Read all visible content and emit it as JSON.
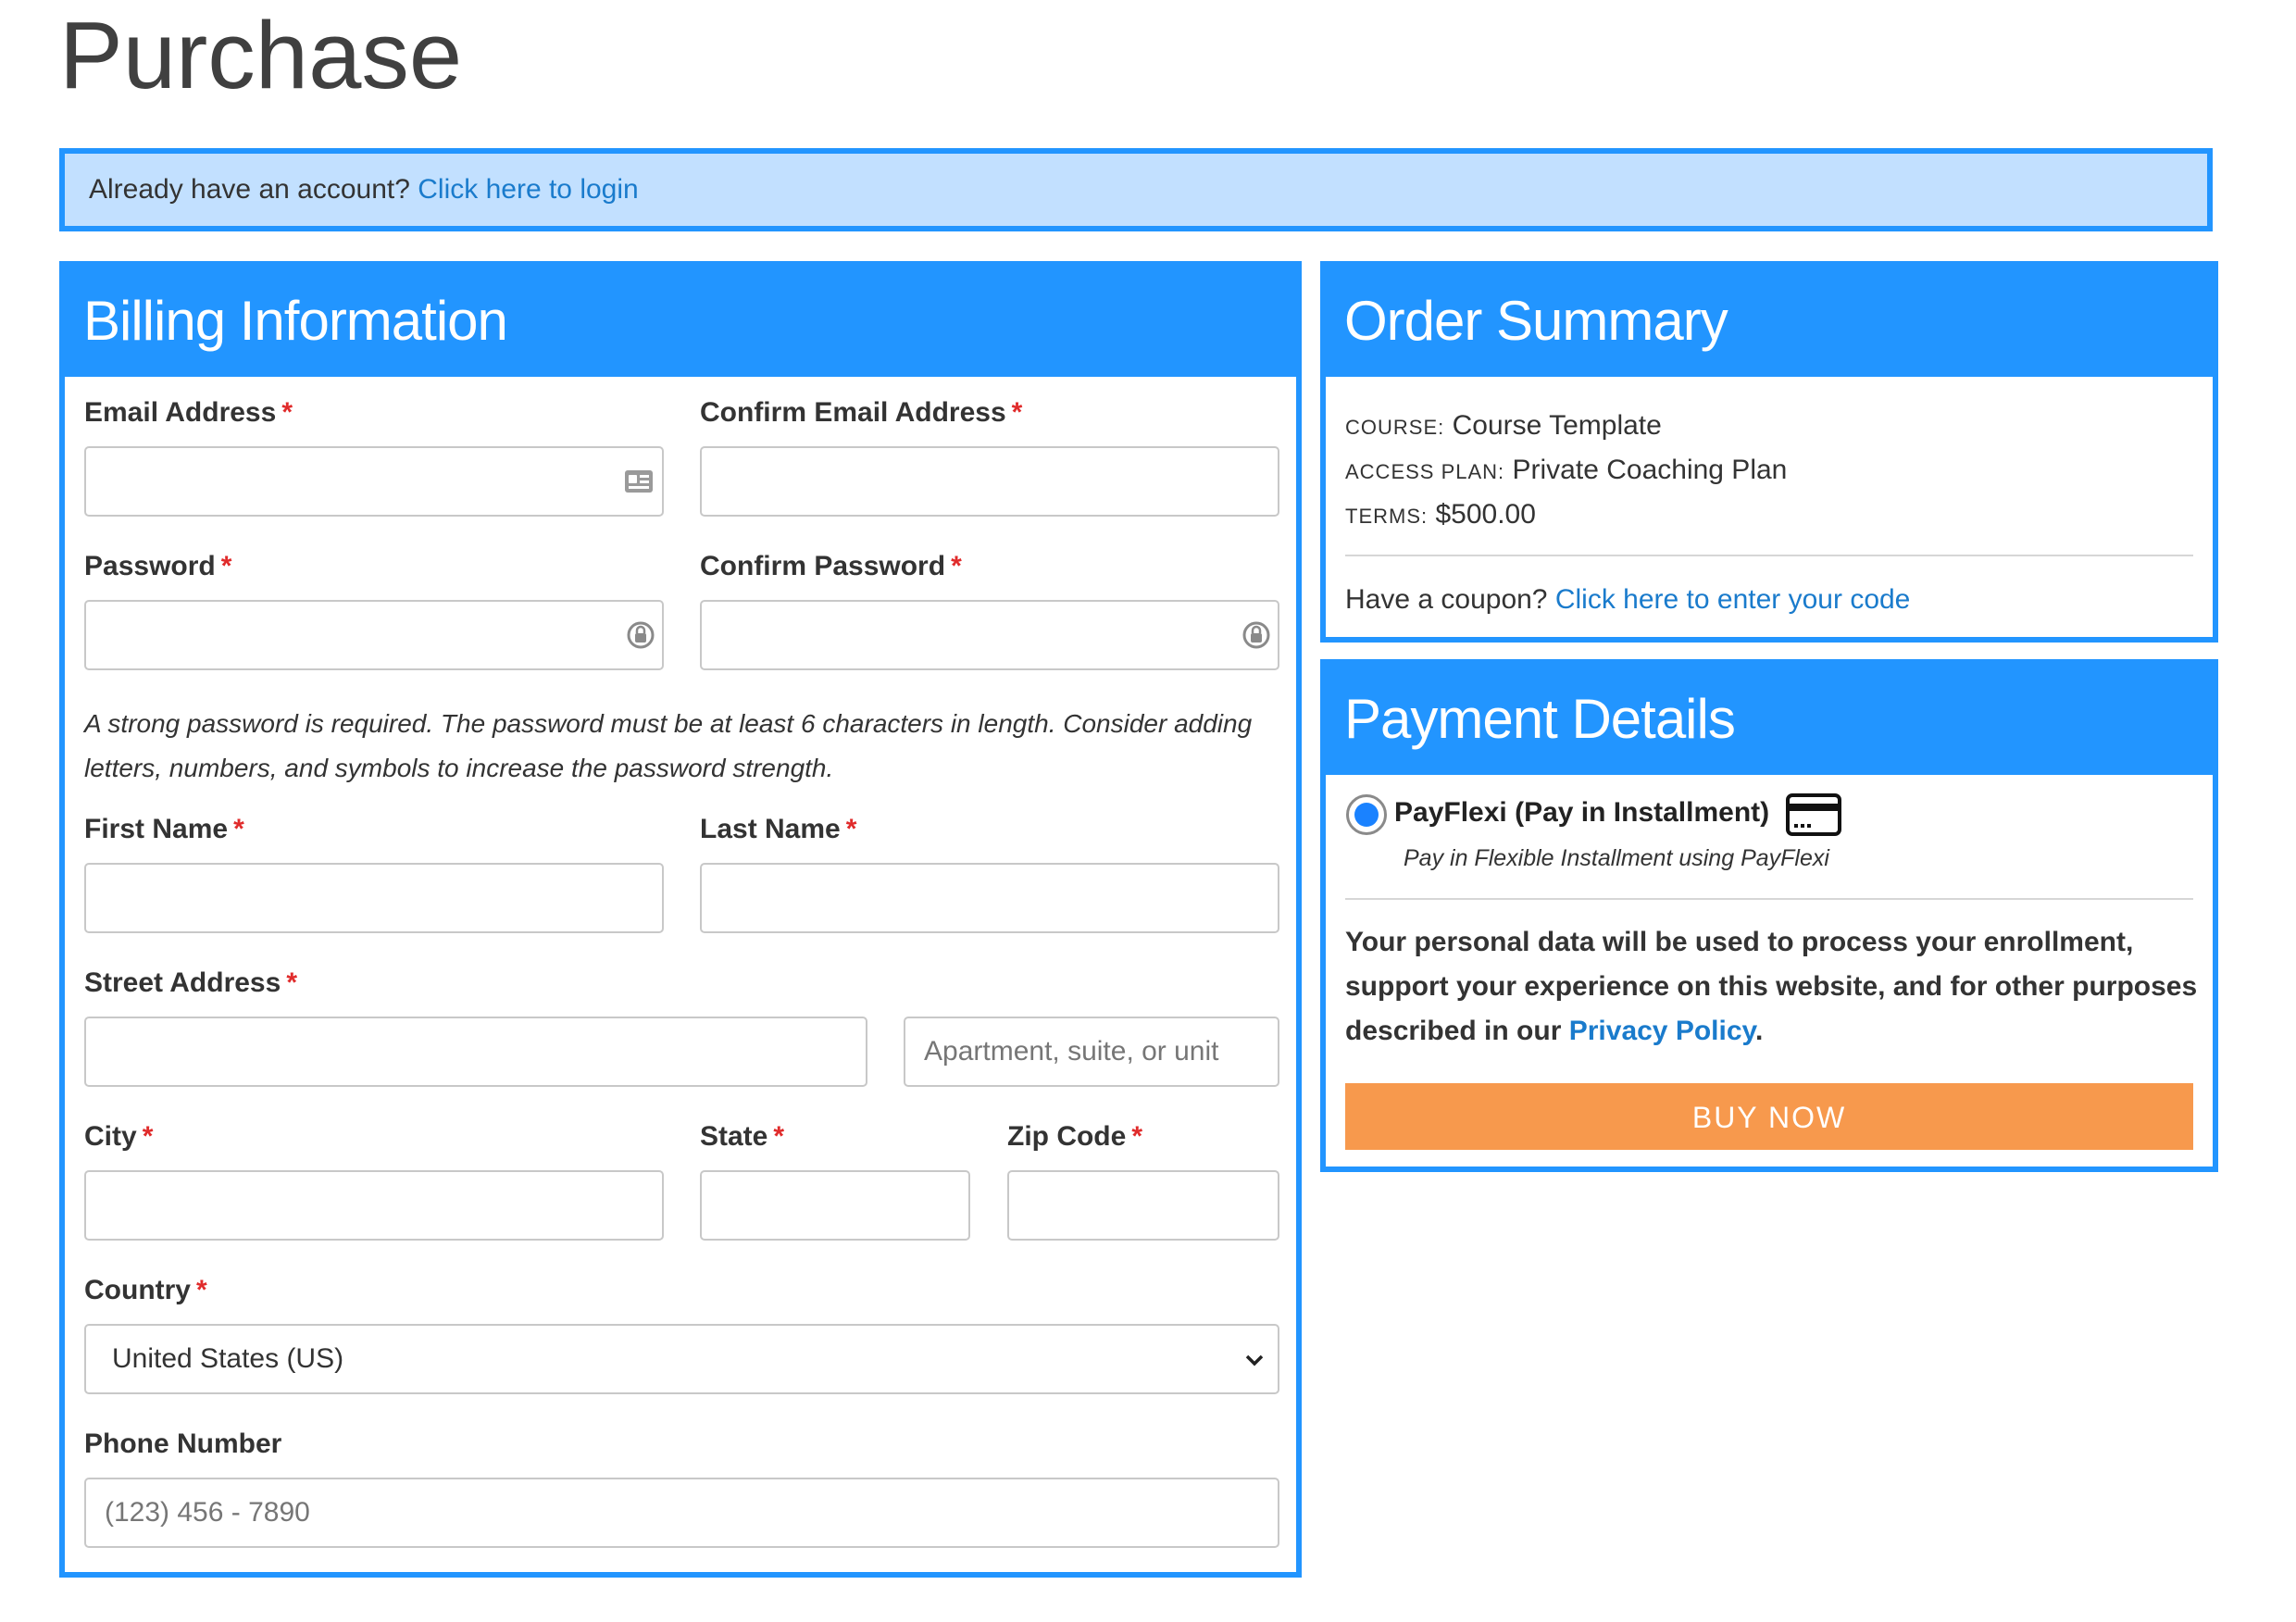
{
  "page": {
    "title": "Purchase"
  },
  "login_notice": {
    "text": "Already have an account?",
    "link": "Click here to login"
  },
  "billing": {
    "header": "Billing Information",
    "email_label": "Email Address",
    "confirm_email_label": "Confirm Email Address",
    "password_label": "Password",
    "confirm_password_label": "Confirm Password",
    "password_hint": "A strong password is required. The password must be at least 6 characters in length. Consider adding letters, numbers, and symbols to increase the password strength.",
    "first_name_label": "First Name",
    "last_name_label": "Last Name",
    "street_label": "Street Address",
    "street2_placeholder": "Apartment, suite, or unit",
    "city_label": "City",
    "state_label": "State",
    "zip_label": "Zip Code",
    "country_label": "Country",
    "country_value": "United States (US)",
    "phone_label": "Phone Number",
    "phone_placeholder": "(123) 456 - 7890",
    "required_mark": "*"
  },
  "summary": {
    "header": "Order Summary",
    "course_label": "Course:",
    "course_value": "Course Template",
    "plan_label": "Access Plan:",
    "plan_value": "Private Coaching Plan",
    "terms_label": "Terms:",
    "terms_value": "$500.00",
    "coupon_text": "Have a coupon?",
    "coupon_link": "Click here to enter your code"
  },
  "payment": {
    "header": "Payment Details",
    "gateway_title": "PayFlexi (Pay in Installment)",
    "gateway_desc": "Pay in Flexible Installment using PayFlexi",
    "gateway_selected": true,
    "privacy_text": "Your personal data will be used to process your enrollment, support your experience on this website, and for other purposes described in our",
    "privacy_link": "Privacy Policy",
    "privacy_end": ".",
    "buy_label": "BUY NOW"
  },
  "colors": {
    "accent": "#2295ff",
    "notice_bg": "#c2e0ff",
    "link": "#1a7bcc",
    "required": "#e02b2b",
    "buy_button": "#f7994d"
  },
  "icons": {
    "email_field": "contact-card-icon",
    "password_field": "password-manager-icon",
    "gateway": "credit-card-icon",
    "select": "chevron-down-icon"
  }
}
